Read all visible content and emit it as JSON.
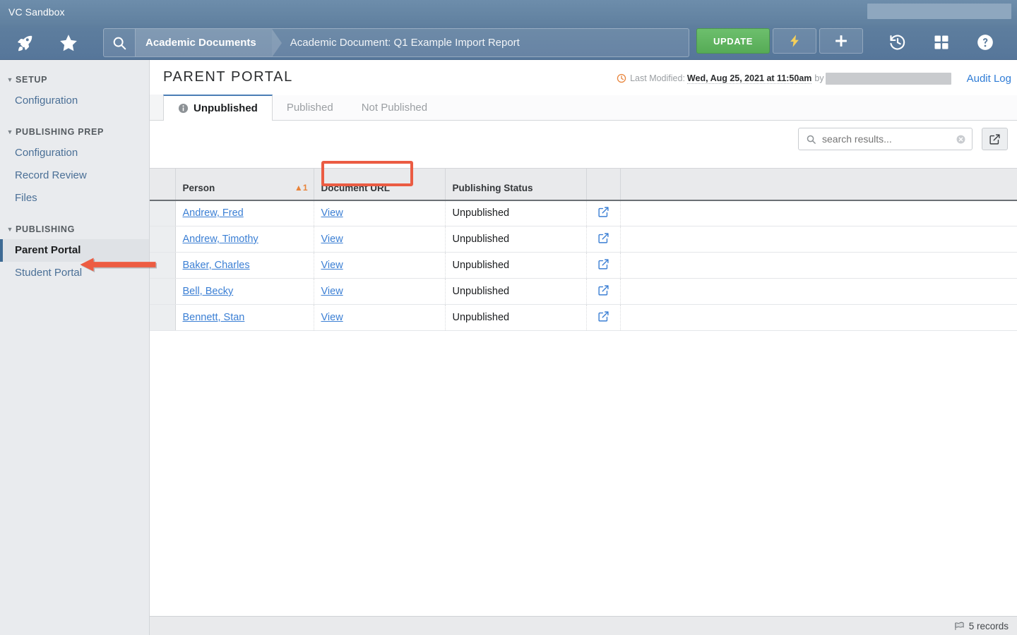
{
  "window": {
    "title": "VC Sandbox",
    "user_redacted": true
  },
  "nav": {
    "rocket_icon": "rocket-icon",
    "star_icon": "star-icon",
    "search_icon": "search-icon",
    "breadcrumb": {
      "primary": "Academic Documents",
      "current": "Academic Document: Q1 Example Import Report"
    },
    "update_label": "UPDATE",
    "lightning_icon": "lightning-icon",
    "add_icon": "plus-icon",
    "history_icon": "history-icon",
    "grid_icon": "grid-icon",
    "help_icon": "help-icon",
    "accent_green": "#56ab56",
    "header_blue": "#5e7e9e"
  },
  "sidebar": {
    "groups": [
      {
        "label": "SETUP",
        "items": [
          {
            "label": "Configuration",
            "active": false
          }
        ]
      },
      {
        "label": "PUBLISHING PREP",
        "items": [
          {
            "label": "Configuration",
            "active": false
          },
          {
            "label": "Record Review",
            "active": false
          },
          {
            "label": "Files",
            "active": false
          }
        ]
      },
      {
        "label": "PUBLISHING",
        "items": [
          {
            "label": "Parent Portal",
            "active": true
          },
          {
            "label": "Student Portal",
            "active": false
          }
        ]
      }
    ]
  },
  "main": {
    "page_title": "PARENT PORTAL",
    "modified": {
      "label": "Last Modified:",
      "date": "Wed, Aug 25, 2021 at 11:50am",
      "by": "by",
      "user_redacted": true
    },
    "audit_log_label": "Audit Log",
    "tabs": [
      {
        "label": "Unpublished",
        "active": true,
        "has_info_icon": true
      },
      {
        "label": "Published",
        "active": false,
        "has_info_icon": false
      },
      {
        "label": "Not Published",
        "active": false,
        "has_info_icon": false
      }
    ],
    "search": {
      "value": "",
      "placeholder": "search results..."
    },
    "table": {
      "columns": [
        {
          "label": "Person",
          "sort": "1",
          "sort_dir": "asc"
        },
        {
          "label": "Document URL",
          "sort": "",
          "sort_dir": ""
        },
        {
          "label": "Publishing Status",
          "sort": "",
          "sort_dir": ""
        }
      ],
      "rows": [
        {
          "person": "Andrew, Fred",
          "document_url": "View",
          "status": "Unpublished"
        },
        {
          "person": "Andrew, Timothy",
          "document_url": "View",
          "status": "Unpublished"
        },
        {
          "person": "Baker, Charles",
          "document_url": "View",
          "status": "Unpublished"
        },
        {
          "person": "Bell, Becky",
          "document_url": "View",
          "status": "Unpublished"
        },
        {
          "person": "Bennett, Stan",
          "document_url": "View",
          "status": "Unpublished"
        }
      ]
    },
    "footer": {
      "record_count": "5 records"
    }
  },
  "annotations": {
    "highlight_color": "#eb5c43",
    "tab_highlight_target": "Unpublished",
    "arrow_target": "Parent Portal"
  }
}
